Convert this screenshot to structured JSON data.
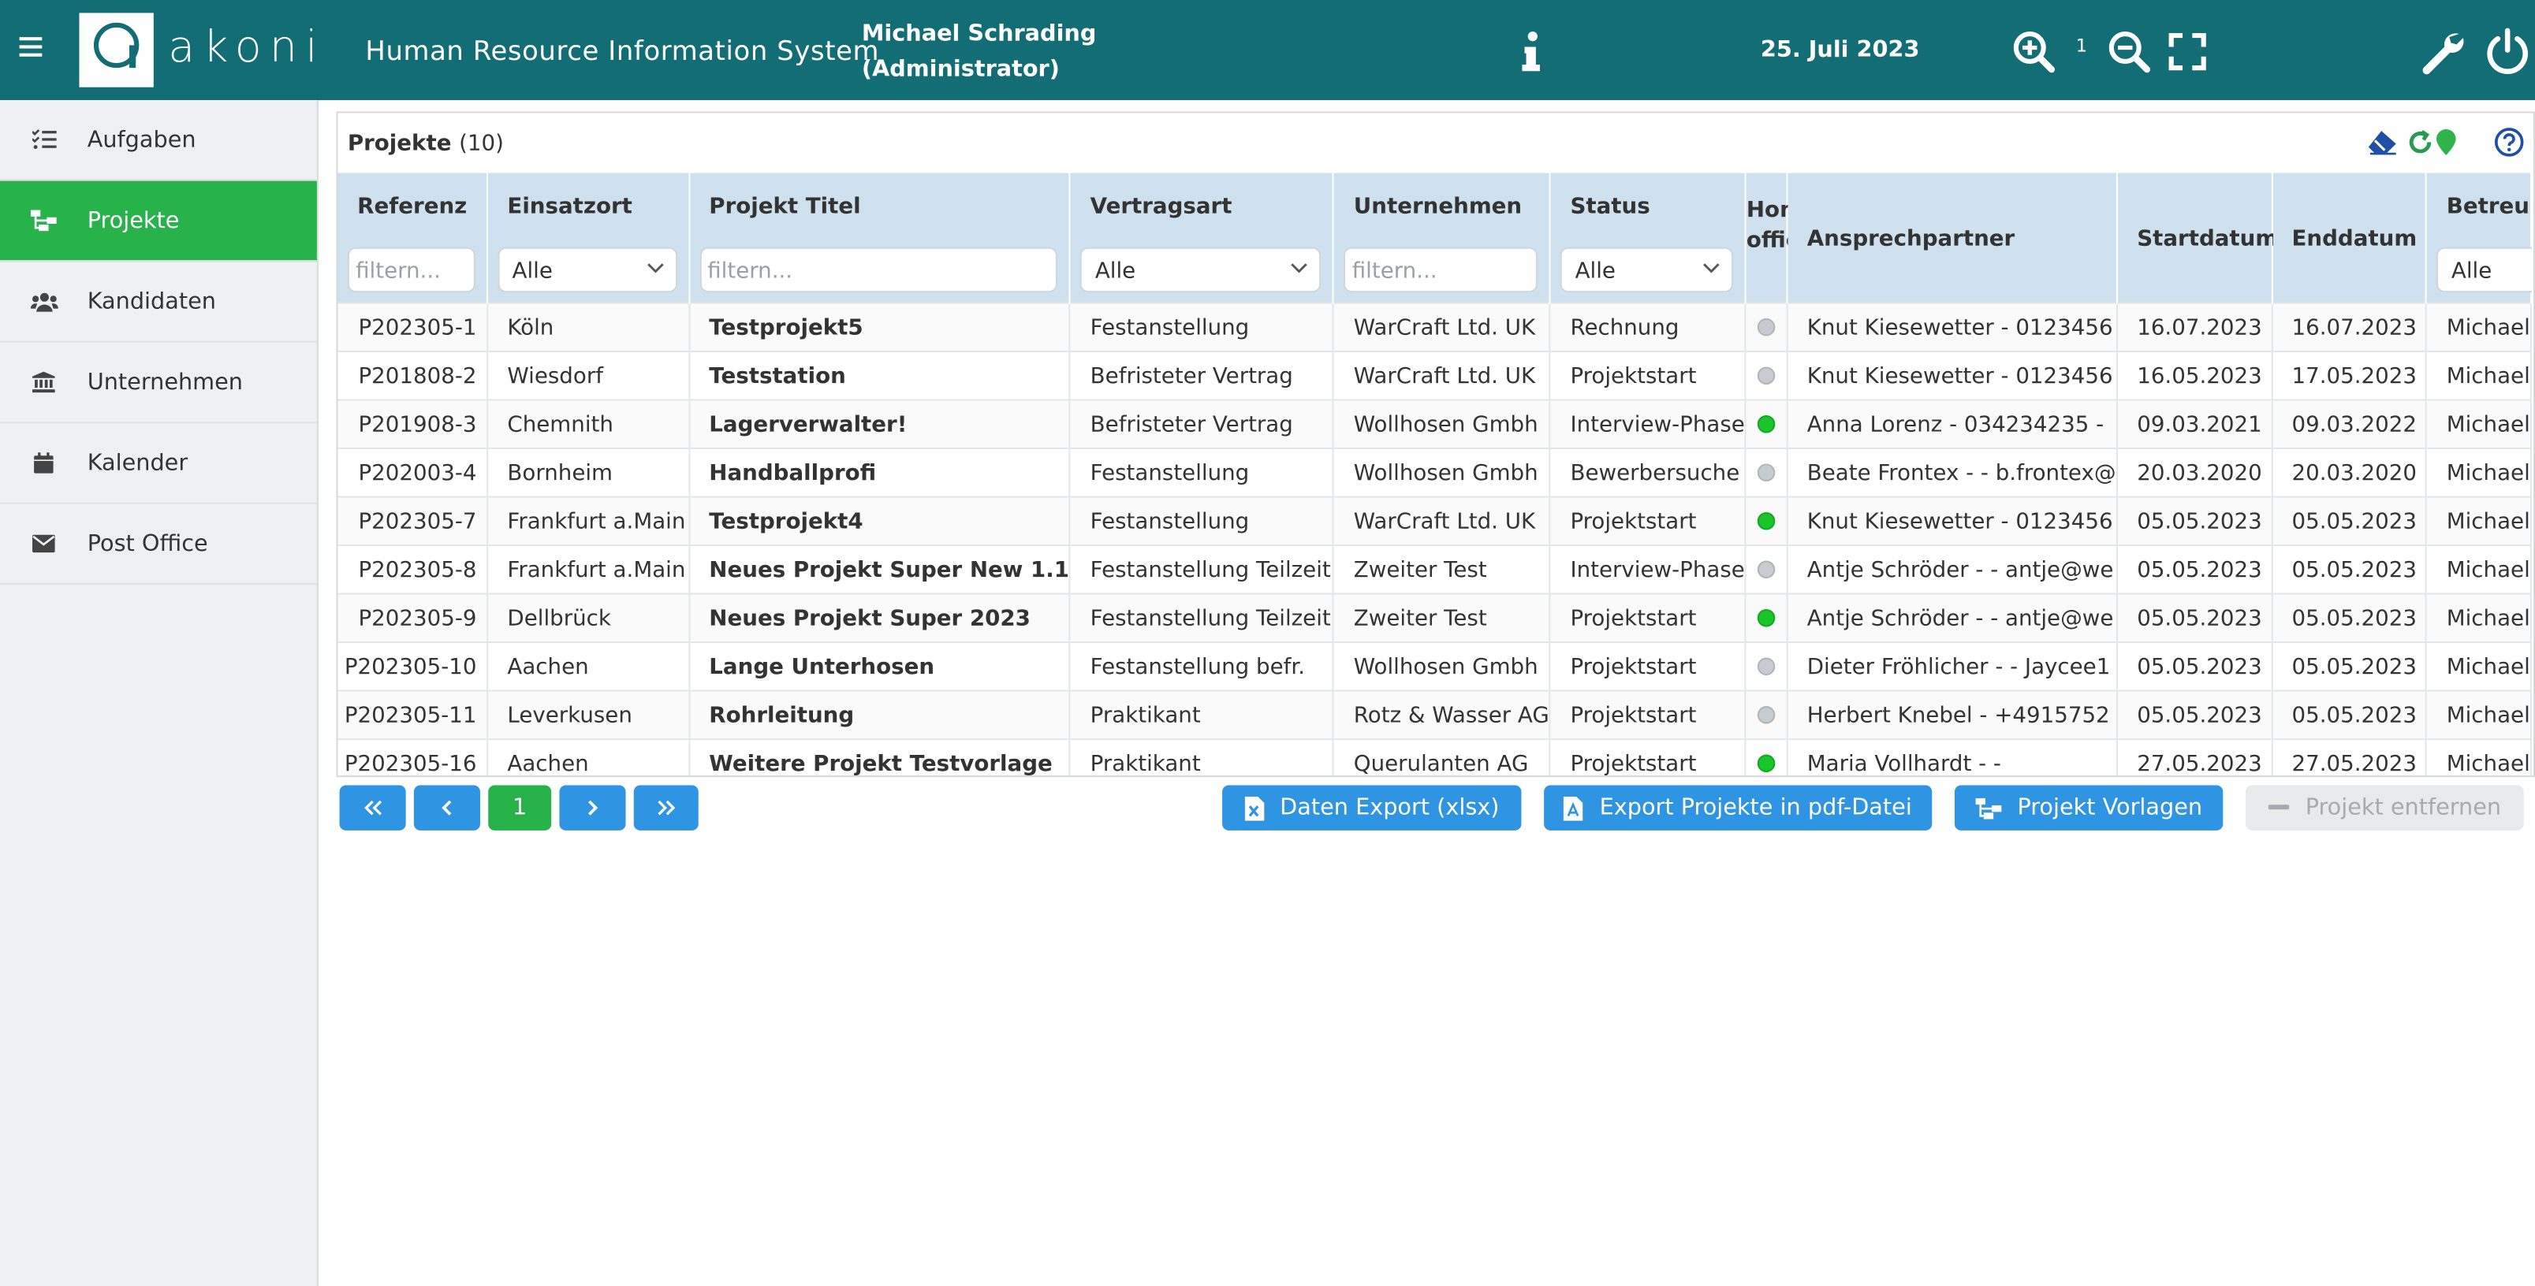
{
  "header": {
    "logo_text": "akoni",
    "app_title": "Human Resource Information System",
    "user_name": "Michael Schrading",
    "user_role": "(Administrator)",
    "date": "25. Juli 2023",
    "zoom_level": "1",
    "brand_color": "#136d75"
  },
  "sidebar": {
    "items": [
      {
        "label": "Aufgaben",
        "icon": "tasks-icon",
        "active": false
      },
      {
        "label": "Projekte",
        "icon": "sitemap-icon",
        "active": true
      },
      {
        "label": "Kandidaten",
        "icon": "users-icon",
        "active": false
      },
      {
        "label": "Unternehmen",
        "icon": "bank-icon",
        "active": false
      },
      {
        "label": "Kalender",
        "icon": "calendar-icon",
        "active": false
      },
      {
        "label": "Post Office",
        "icon": "envelope-icon",
        "active": false
      }
    ],
    "active_color": "#27b34a"
  },
  "panel": {
    "title": "Projekte",
    "count": "(10)"
  },
  "table": {
    "columns": {
      "ref": "Referenz",
      "einsatzort": "Einsatzort",
      "titel": "Projekt Titel",
      "vertragsart": "Vertragsart",
      "unternehmen": "Unternehmen",
      "status": "Status",
      "home1": "Home",
      "home2": "office",
      "ansprech": "Ansprechpartner",
      "start": "Startdatum",
      "ende": "Enddatum",
      "betreu": "Betreu"
    },
    "filters": {
      "placeholder": "filtern...",
      "select_all": "Alle"
    },
    "rows": [
      {
        "ref": "P202305-1",
        "ort": "Köln",
        "titel": "Testprojekt5",
        "vertrag": "Festanstellung",
        "firma": "WarCraft Ltd. UK",
        "status": "Rechnung",
        "home": false,
        "ansprech": "Knut Kiesewetter - 0123456",
        "start": "16.07.2023",
        "ende": "16.07.2023",
        "betreu": "Michael"
      },
      {
        "ref": "P201808-2",
        "ort": "Wiesdorf",
        "titel": "Teststation",
        "vertrag": "Befristeter Vertrag",
        "firma": "WarCraft Ltd. UK",
        "status": "Projektstart",
        "home": false,
        "ansprech": "Knut Kiesewetter - 0123456",
        "start": "16.05.2023",
        "ende": "17.05.2023",
        "betreu": "Michael"
      },
      {
        "ref": "P201908-3",
        "ort": "Chemnith",
        "titel": "Lagerverwalter!",
        "vertrag": "Befristeter Vertrag",
        "firma": "Wollhosen Gmbh",
        "status": "Interview-Phase",
        "home": true,
        "ansprech": "Anna Lorenz - 034234235 -",
        "start": "09.03.2021",
        "ende": "09.03.2022",
        "betreu": "Michael"
      },
      {
        "ref": "P202003-4",
        "ort": "Bornheim",
        "titel": "Handballprofi",
        "vertrag": "Festanstellung",
        "firma": "Wollhosen Gmbh",
        "status": "Bewerbersuche",
        "home": false,
        "ansprech": "Beate Frontex - - b.frontex@",
        "start": "20.03.2020",
        "ende": "20.03.2020",
        "betreu": "Michael"
      },
      {
        "ref": "P202305-7",
        "ort": "Frankfurt a.Main",
        "titel": "Testprojekt4",
        "vertrag": "Festanstellung",
        "firma": "WarCraft Ltd. UK",
        "status": "Projektstart",
        "home": true,
        "ansprech": "Knut Kiesewetter - 0123456",
        "start": "05.05.2023",
        "ende": "05.05.2023",
        "betreu": "Michael"
      },
      {
        "ref": "P202305-8",
        "ort": "Frankfurt a.Main",
        "titel": "Neues Projekt Super New 1.1",
        "vertrag": "Festanstellung Teilzeit",
        "firma": "Zweiter Test",
        "status": "Interview-Phase",
        "home": false,
        "ansprech": "Antje Schröder - - antje@we",
        "start": "05.05.2023",
        "ende": "05.05.2023",
        "betreu": "Michael"
      },
      {
        "ref": "P202305-9",
        "ort": "Dellbrück",
        "titel": "Neues Projekt Super 2023",
        "vertrag": "Festanstellung Teilzeit",
        "firma": "Zweiter Test",
        "status": "Projektstart",
        "home": true,
        "ansprech": "Antje Schröder - - antje@we",
        "start": "05.05.2023",
        "ende": "05.05.2023",
        "betreu": "Michael"
      },
      {
        "ref": "P202305-10",
        "ort": "Aachen",
        "titel": "Lange Unterhosen",
        "vertrag": "Festanstellung befr.",
        "firma": "Wollhosen Gmbh",
        "status": "Projektstart",
        "home": false,
        "ansprech": "Dieter Fröhlicher - - Jaycee1",
        "start": "05.05.2023",
        "ende": "05.05.2023",
        "betreu": "Michael"
      },
      {
        "ref": "P202305-11",
        "ort": "Leverkusen",
        "titel": "Rohrleitung",
        "vertrag": "Praktikant",
        "firma": "Rotz & Wasser AG",
        "status": "Projektstart",
        "home": false,
        "ansprech": "Herbert Knebel - +4915752",
        "start": "05.05.2023",
        "ende": "05.05.2023",
        "betreu": "Michael"
      },
      {
        "ref": "P202305-16",
        "ort": "Aachen",
        "titel": "Weitere Projekt Testvorlage",
        "vertrag": "Praktikant",
        "firma": "Querulanten AG",
        "status": "Projektstart",
        "home": true,
        "ansprech": "Maria Vollhardt - -",
        "start": "27.05.2023",
        "ende": "27.05.2023",
        "betreu": "Michael"
      }
    ]
  },
  "pager": {
    "first": "«",
    "prev": "‹",
    "current": "1",
    "next": "›",
    "last": "»"
  },
  "actions": {
    "export_xlsx": "Daten Export (xlsx)",
    "export_pdf": "Export Projekte in pdf-Datei",
    "templates": "Projekt Vorlagen",
    "remove": "Projekt entfernen"
  }
}
